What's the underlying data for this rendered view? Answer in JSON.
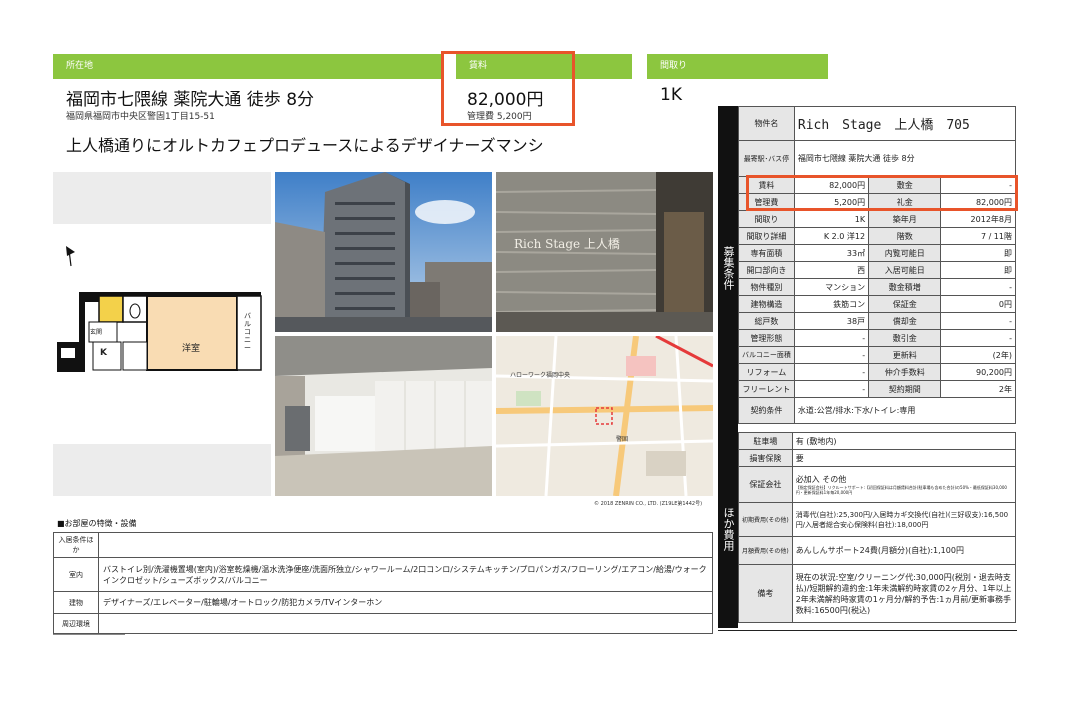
{
  "header": {
    "location_label": "所在地",
    "rent_label": "賃料",
    "layout_label": "間取り",
    "access": "福岡市七隈線 薬院大通 徒歩 8分",
    "address": "福岡県福岡市中央区警固1丁目15-51",
    "rent": "82,000円",
    "mgmt_fee_line": "管理費 5,200円",
    "layout": "1K"
  },
  "catch_copy": "上人橋通りにオルトカフェプロデュースによるデザイナーズマンシ",
  "floorplan": {
    "room_western": "洋室",
    "room_entrance": "玄関",
    "kitchen": "K",
    "balcony": "バルコニー"
  },
  "photos": {
    "sign_text": "Rich Stage 上人橋",
    "map_label_hello": "ハローワーク福岡中央",
    "map_label_takeda": "警固",
    "map_copyright": "© 2018 ZENRIN CO., LTD. (Z19LE第1442号)"
  },
  "features": {
    "title": "■お部屋の特徴・設備",
    "rows": [
      {
        "label": "入居条件ほか",
        "value": ""
      },
      {
        "label": "室内",
        "value": "バストイレ別/洗濯機置場(室内)/浴室乾燥機/温水洗浄便座/洗面所独立/シャワールーム/2口コンロ/システムキッチン/プロパンガス/フローリング/エアコン/給湯/ウォークインクロゼット/シューズボックス/バルコニー"
      },
      {
        "label": "建物",
        "value": "デザイナーズ/エレベーター/駐輪場/オートロック/防犯カメラ/TVインターホン"
      },
      {
        "label": "周辺環境",
        "value": ""
      }
    ]
  },
  "side_labels": {
    "recruit": "募集条件",
    "other": "ほか費用"
  },
  "info": {
    "property_name_label": "物件名",
    "property_name": "Rich　Stage　上人橋　705",
    "station_label": "最寄駅･バス停",
    "station": "福岡市七隈線 薬院大通 徒歩 8分",
    "rows": [
      [
        "賃料",
        "82,000円",
        "敷金",
        "-"
      ],
      [
        "管理費",
        "5,200円",
        "礼金",
        "82,000円"
      ],
      [
        "間取り",
        "1K",
        "築年月",
        "2012年8月"
      ],
      [
        "間取り詳細",
        "K 2.0 洋12",
        "階数",
        "7 / 11階"
      ],
      [
        "専有面積",
        "33㎡",
        "内覧可能日",
        "即"
      ],
      [
        "開口部向き",
        "西",
        "入居可能日",
        "即"
      ],
      [
        "物件種別",
        "マンション",
        "敷金積増",
        "-"
      ],
      [
        "建物構造",
        "鉄筋コン",
        "保証金",
        "0円"
      ],
      [
        "総戸数",
        "38戸",
        "償却金",
        "-"
      ],
      [
        "管理形態",
        "-",
        "敷引金",
        "-"
      ],
      [
        "バルコニー面積",
        "-",
        "更新料",
        "(2年)"
      ],
      [
        "リフォーム",
        "-",
        "仲介手数料",
        "90,200円"
      ],
      [
        "フリーレント",
        "-",
        "契約期間",
        "2年"
      ]
    ],
    "contract_label": "契約条件",
    "contract": "水道:公営/排水:下水/トイレ:専用"
  },
  "other": {
    "parking_label": "駐車場",
    "parking": "有 (敷地内)",
    "insurance_label": "損害保険",
    "insurance": "要",
    "guarantee_label": "保証会社",
    "guarantee_main": "必加入 その他",
    "guarantee_detail": "【指定保証会社】リクルートサポート:【初回保証料は月額賃料合計(駐車場も含めた合計)の50%・最低保証料30,000円・更新保証料1年毎20,000円",
    "initial_label": "初期費用(その他)",
    "initial": "消毒代(自社):25,300円/入居時カギ交換代(自社)(三好収支):16,500円/入居者総合安心保険料(自社):18,000円",
    "monthly_label": "月額費用(その他)",
    "monthly": "あんしんサポート24費(月額分)(自社):1,100円",
    "remarks_label": "備考",
    "remarks": "現在の状況:空室/クリーニング代:30,000円(税別・退去時支払)/短期解約違約金:1年未満解約時家賃の2ヶ月分、1年以上2年未満解約時家賃の1ヶ月分/解約予告:1ヵ月前/更新事務手数料:16500円(税込)"
  },
  "colors": {
    "accent_green": "#8cc63f",
    "highlight_red": "#e8542a"
  }
}
